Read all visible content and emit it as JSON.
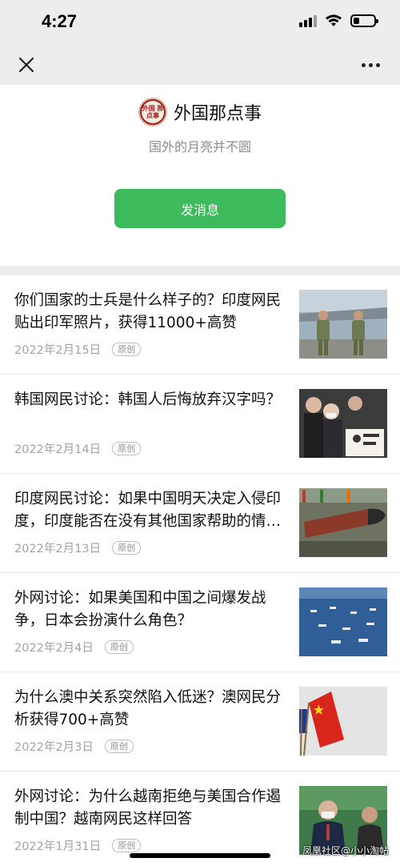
{
  "status_bar": {
    "time": "4:27"
  },
  "account": {
    "logo_text": "外国 那点事",
    "name": "外国那点事",
    "description": "国外的月亮并不圆",
    "message_button": "发消息"
  },
  "articles": [
    {
      "title": "你们国家的士兵是什么样子的？印度网民贴出印军照片，获得11000+高赞",
      "date": "2022年2月15日",
      "badge": "原创",
      "thumb_icon": "soldiers-photo-icon"
    },
    {
      "title": "韩国网民讨论：韩国人后悔放弃汉字吗？",
      "date": "2022年2月14日",
      "badge": "原创",
      "thumb_icon": "protest-crowd-photo-icon"
    },
    {
      "title": "印度网民讨论：如果中国明天决定入侵印度，印度能否在没有其他国家帮助的情况下应对？",
      "date": "2022年2月13日",
      "badge": "原创",
      "thumb_icon": "missile-photo-icon"
    },
    {
      "title": "外网讨论：如果美国和中国之间爆发战争，日本会扮演什么角色？",
      "date": "2022年2月4日",
      "badge": "原创",
      "thumb_icon": "naval-fleet-photo-icon"
    },
    {
      "title": "为什么澳中关系突然陷入低迷？澳网民分析获得700+高赞",
      "date": "2022年2月3日",
      "badge": "原创",
      "thumb_icon": "flags-photo-icon"
    },
    {
      "title": "外网讨论：为什么越南拒绝与美国合作遏制中国？越南网民这样回答",
      "date": "2022年1月31日",
      "badge": "原创",
      "thumb_icon": "leaders-photo-icon"
    }
  ],
  "watermark": "凤凰社区@小小淘帖"
}
